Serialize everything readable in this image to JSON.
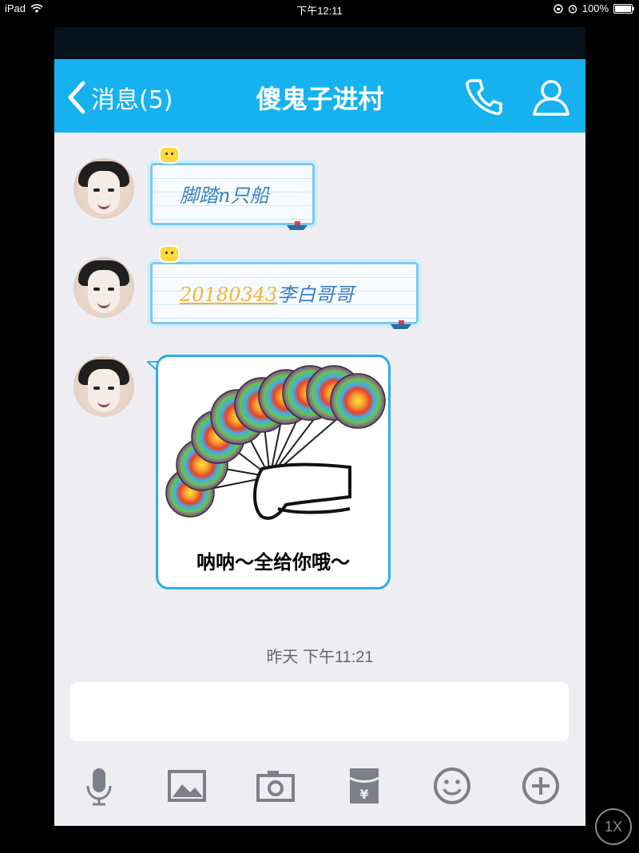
{
  "statusbar": {
    "device": "iPad",
    "time": "下午12:11",
    "battery": "100%",
    "battery_level": 1.0
  },
  "navbar": {
    "back_label": "消息(5)",
    "title": "傻鬼子进村"
  },
  "messages": [
    {
      "type": "text",
      "text": "脚踏n只船"
    },
    {
      "type": "text",
      "number": "20180343",
      "suffix": "李白哥哥"
    },
    {
      "type": "sticker",
      "caption": "呐呐～全给你哦～"
    }
  ],
  "timestamp": "昨天 下午11:21",
  "input": {
    "value": ""
  },
  "toolbar": {
    "items": [
      "microphone-icon",
      "image-icon",
      "camera-icon",
      "red-packet-icon",
      "emoji-icon",
      "plus-icon"
    ]
  },
  "zoom": "1X",
  "colors": {
    "nav_blue": "#16b2ef",
    "bubble_border": "#7cc8ef",
    "link_orange": "#f3b43c",
    "text_blue": "#3a7fc0"
  }
}
